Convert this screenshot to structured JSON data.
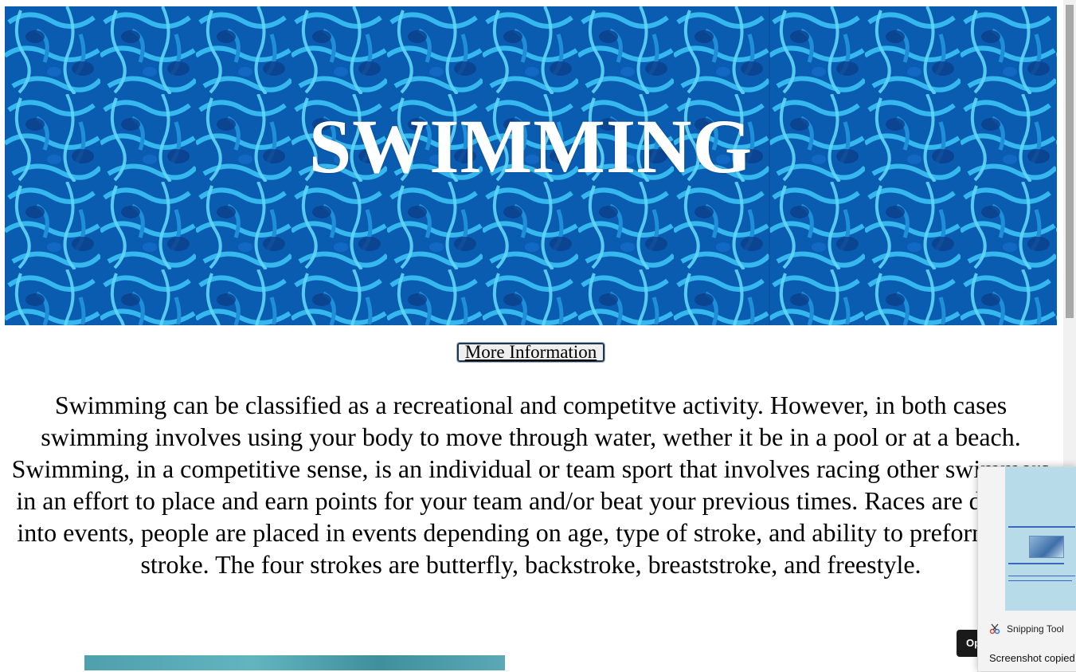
{
  "hero": {
    "title": "SWIMMING",
    "background": "pool-water-image"
  },
  "more_info_button": {
    "label": "More Information"
  },
  "intro": {
    "text": "Swimming can be classified as a recreational and competitve activity. However, in both cases swimming involves using your body to move through water, wether it be in a pool or at a beach. Swimming, in a competitive sense, is an individual or team sport that involves racing other swimmers in an effort to place and earn points for your team and/or beat your previous times. Races are divided into events, people are placed in events depending on age, type of stroke, and ability to preform each stroke. The four strokes are butterfly, backstroke, breaststroke, and freestyle."
  },
  "notification": {
    "app_name": "Snipping Tool",
    "message": "Screenshot copied",
    "open_button": "Op"
  },
  "colors": {
    "water_dark": "#0b5fb4",
    "water_light": "#4fd0f5",
    "button_border": "#1f3550"
  }
}
